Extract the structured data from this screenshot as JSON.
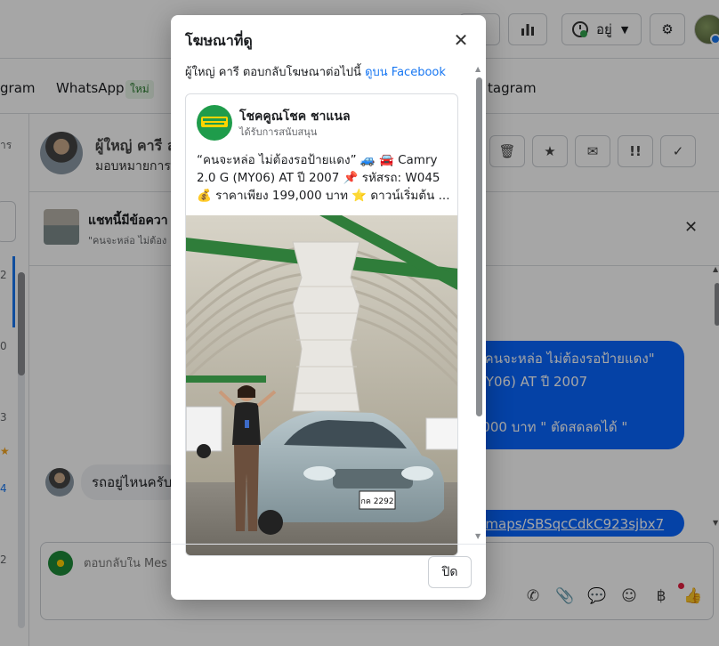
{
  "topbar": {
    "status_label": "อยู่",
    "icons": [
      "dashboard-icon",
      "bar-chart-icon",
      "status-icon",
      "chevron-down-icon",
      "gear-icon"
    ]
  },
  "tabs": {
    "partial_left": "gram",
    "whatsapp": "WhatsApp",
    "whatsapp_badge": "ใหม่",
    "partial_right": "tagram"
  },
  "left": {
    "partial_1": "าร",
    "n1": "2",
    "n2": "0",
    "n3": "3",
    "n4": "4",
    "n5": "2"
  },
  "chat": {
    "name": "ผู้ใหญ่ คารี ล",
    "sub": "มอบหมายการ",
    "ad_strip_title": "แชทนี้มีข้อควา",
    "ad_strip_sub": "\"คนจะหล่อ ไม่ต้อง",
    "bubble_out_1_line1": "! \"คนจะหล่อ ไม่ต้องรอป้ายแดง\"",
    "bubble_out_1_line2": "(MY06) AT ปี 2007",
    "bubble_out_1_line3": "9,000 บาท \" ตัดสดลดได้ \"",
    "bubble_out_2": "ol/maps/SBSqcCdkC923sjbx7",
    "bubble_in": "รถอยู่ไหนครับ",
    "composer_placeholder": "ตอบกลับใน Mes"
  },
  "modal": {
    "title": "โฆษณาที่ดู",
    "desc_prefix": "ผู้ใหญ่ คารี ตอบกลับโฆษณาต่อไปนี้ ",
    "desc_link": "ดูบน Facebook",
    "page_name": "โชคคูณโชค ชาแนล",
    "sponsored": "ได้รับการสนับสนุน",
    "ad_line1": "“คนจะหล่อ ไม่ต้องรอป้ายแดง” 🚙 🚘 Camry",
    "ad_line2": "2.0 G (MY06) AT ปี 2007 📌 รหัสรถ: W045",
    "ad_line3": "💰 ราคาเพียง 199,000 บาท ⭐ ดาวน์เริ่มต้น ...",
    "plate_line1": "กค 2292",
    "close_button": "ปิด"
  },
  "colors": {
    "brand_blue": "#0866ff",
    "link_blue": "#1877f2",
    "badge_green": "#2e7d32"
  }
}
